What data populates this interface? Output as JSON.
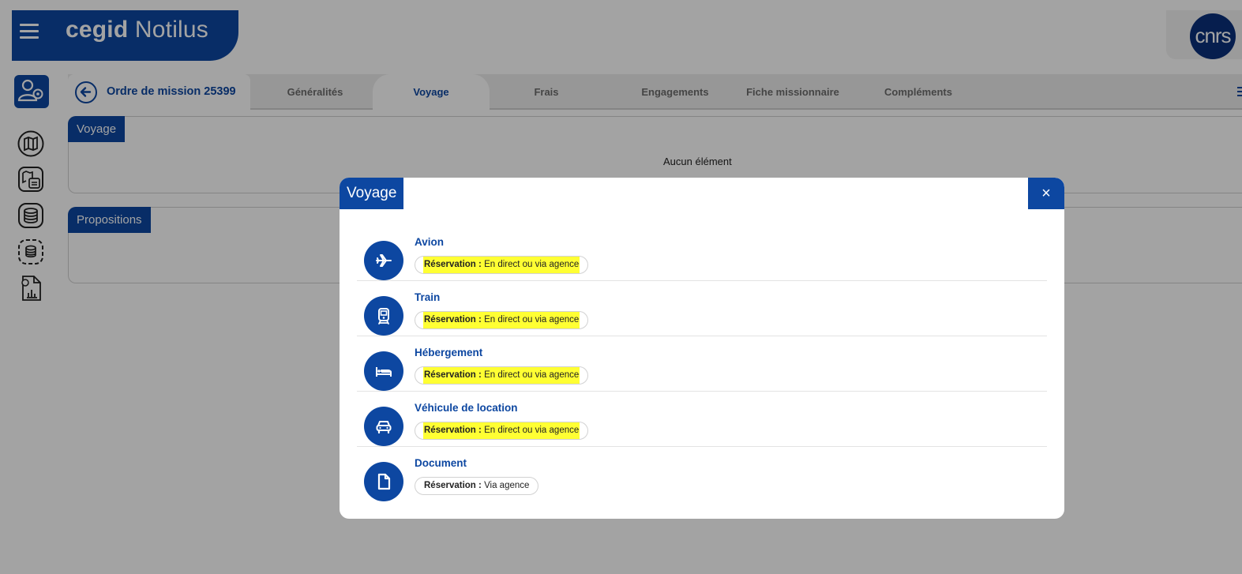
{
  "app": {
    "brand_bold": "cegid",
    "brand_light": "Notilus",
    "logo_text": "cnrs"
  },
  "mission": {
    "title": "Ordre de mission 25399"
  },
  "tabs": [
    {
      "label": "Généralités"
    },
    {
      "label": "Voyage",
      "active": true
    },
    {
      "label": "Frais"
    },
    {
      "label": "Engagements"
    },
    {
      "label": "Fiche missionnaire"
    },
    {
      "label": "Compléments"
    }
  ],
  "panels": {
    "voyage": {
      "label": "Voyage",
      "empty": "Aucun élément"
    },
    "propositions": {
      "label": "Propositions"
    }
  },
  "modal": {
    "title": "Voyage",
    "close": "×",
    "items": [
      {
        "name": "Avion",
        "icon": "plane-icon",
        "key": "Réservation :",
        "value": "En direct ou via agence",
        "highlighted": true
      },
      {
        "name": "Train",
        "icon": "train-icon",
        "key": "Réservation :",
        "value": "En direct ou via agence",
        "highlighted": true
      },
      {
        "name": "Hébergement",
        "icon": "bed-icon",
        "key": "Réservation :",
        "value": "En direct ou via agence",
        "highlighted": true
      },
      {
        "name": "Véhicule de location",
        "icon": "car-icon",
        "key": "Réservation :",
        "value": "En direct ou via agence",
        "highlighted": true
      },
      {
        "name": "Document",
        "icon": "document-icon",
        "key": "Réservation :",
        "value": "Via agence",
        "highlighted": false
      }
    ]
  },
  "colors": {
    "primary": "#0d47a1",
    "highlight": "#ffff33",
    "overlay": "rgba(0,0,0,0.36)"
  }
}
